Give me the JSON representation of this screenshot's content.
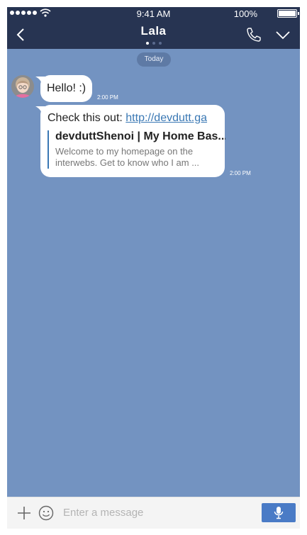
{
  "status_bar": {
    "time": "9:41 AM",
    "battery": "100%"
  },
  "header": {
    "title": "Lala",
    "page_count": 3,
    "active_page": 1
  },
  "chat": {
    "date_label": "Today",
    "messages": [
      {
        "text": "Hello! :)",
        "time": "2:00 PM"
      },
      {
        "text_prefix": "Check this out: ",
        "link": "http://devdutt.ga",
        "preview_title": "devduttShenoi | My Home Bas...",
        "preview_desc": "Welcome to my homepage on the interwebs. Get to know who I am ...",
        "time": "2:00 PM"
      }
    ]
  },
  "composer": {
    "placeholder": "Enter a message"
  },
  "icons": [
    "signal-dots-icon",
    "wifi-icon",
    "battery-icon",
    "back-chevron-icon",
    "phone-call-icon",
    "chevron-down-icon",
    "plus-icon",
    "emoji-icon",
    "microphone-icon"
  ],
  "colors": {
    "header": "#273452",
    "chat_background": "#7393c1",
    "link": "#3a78b4",
    "mic_button": "#4a7bc6"
  }
}
